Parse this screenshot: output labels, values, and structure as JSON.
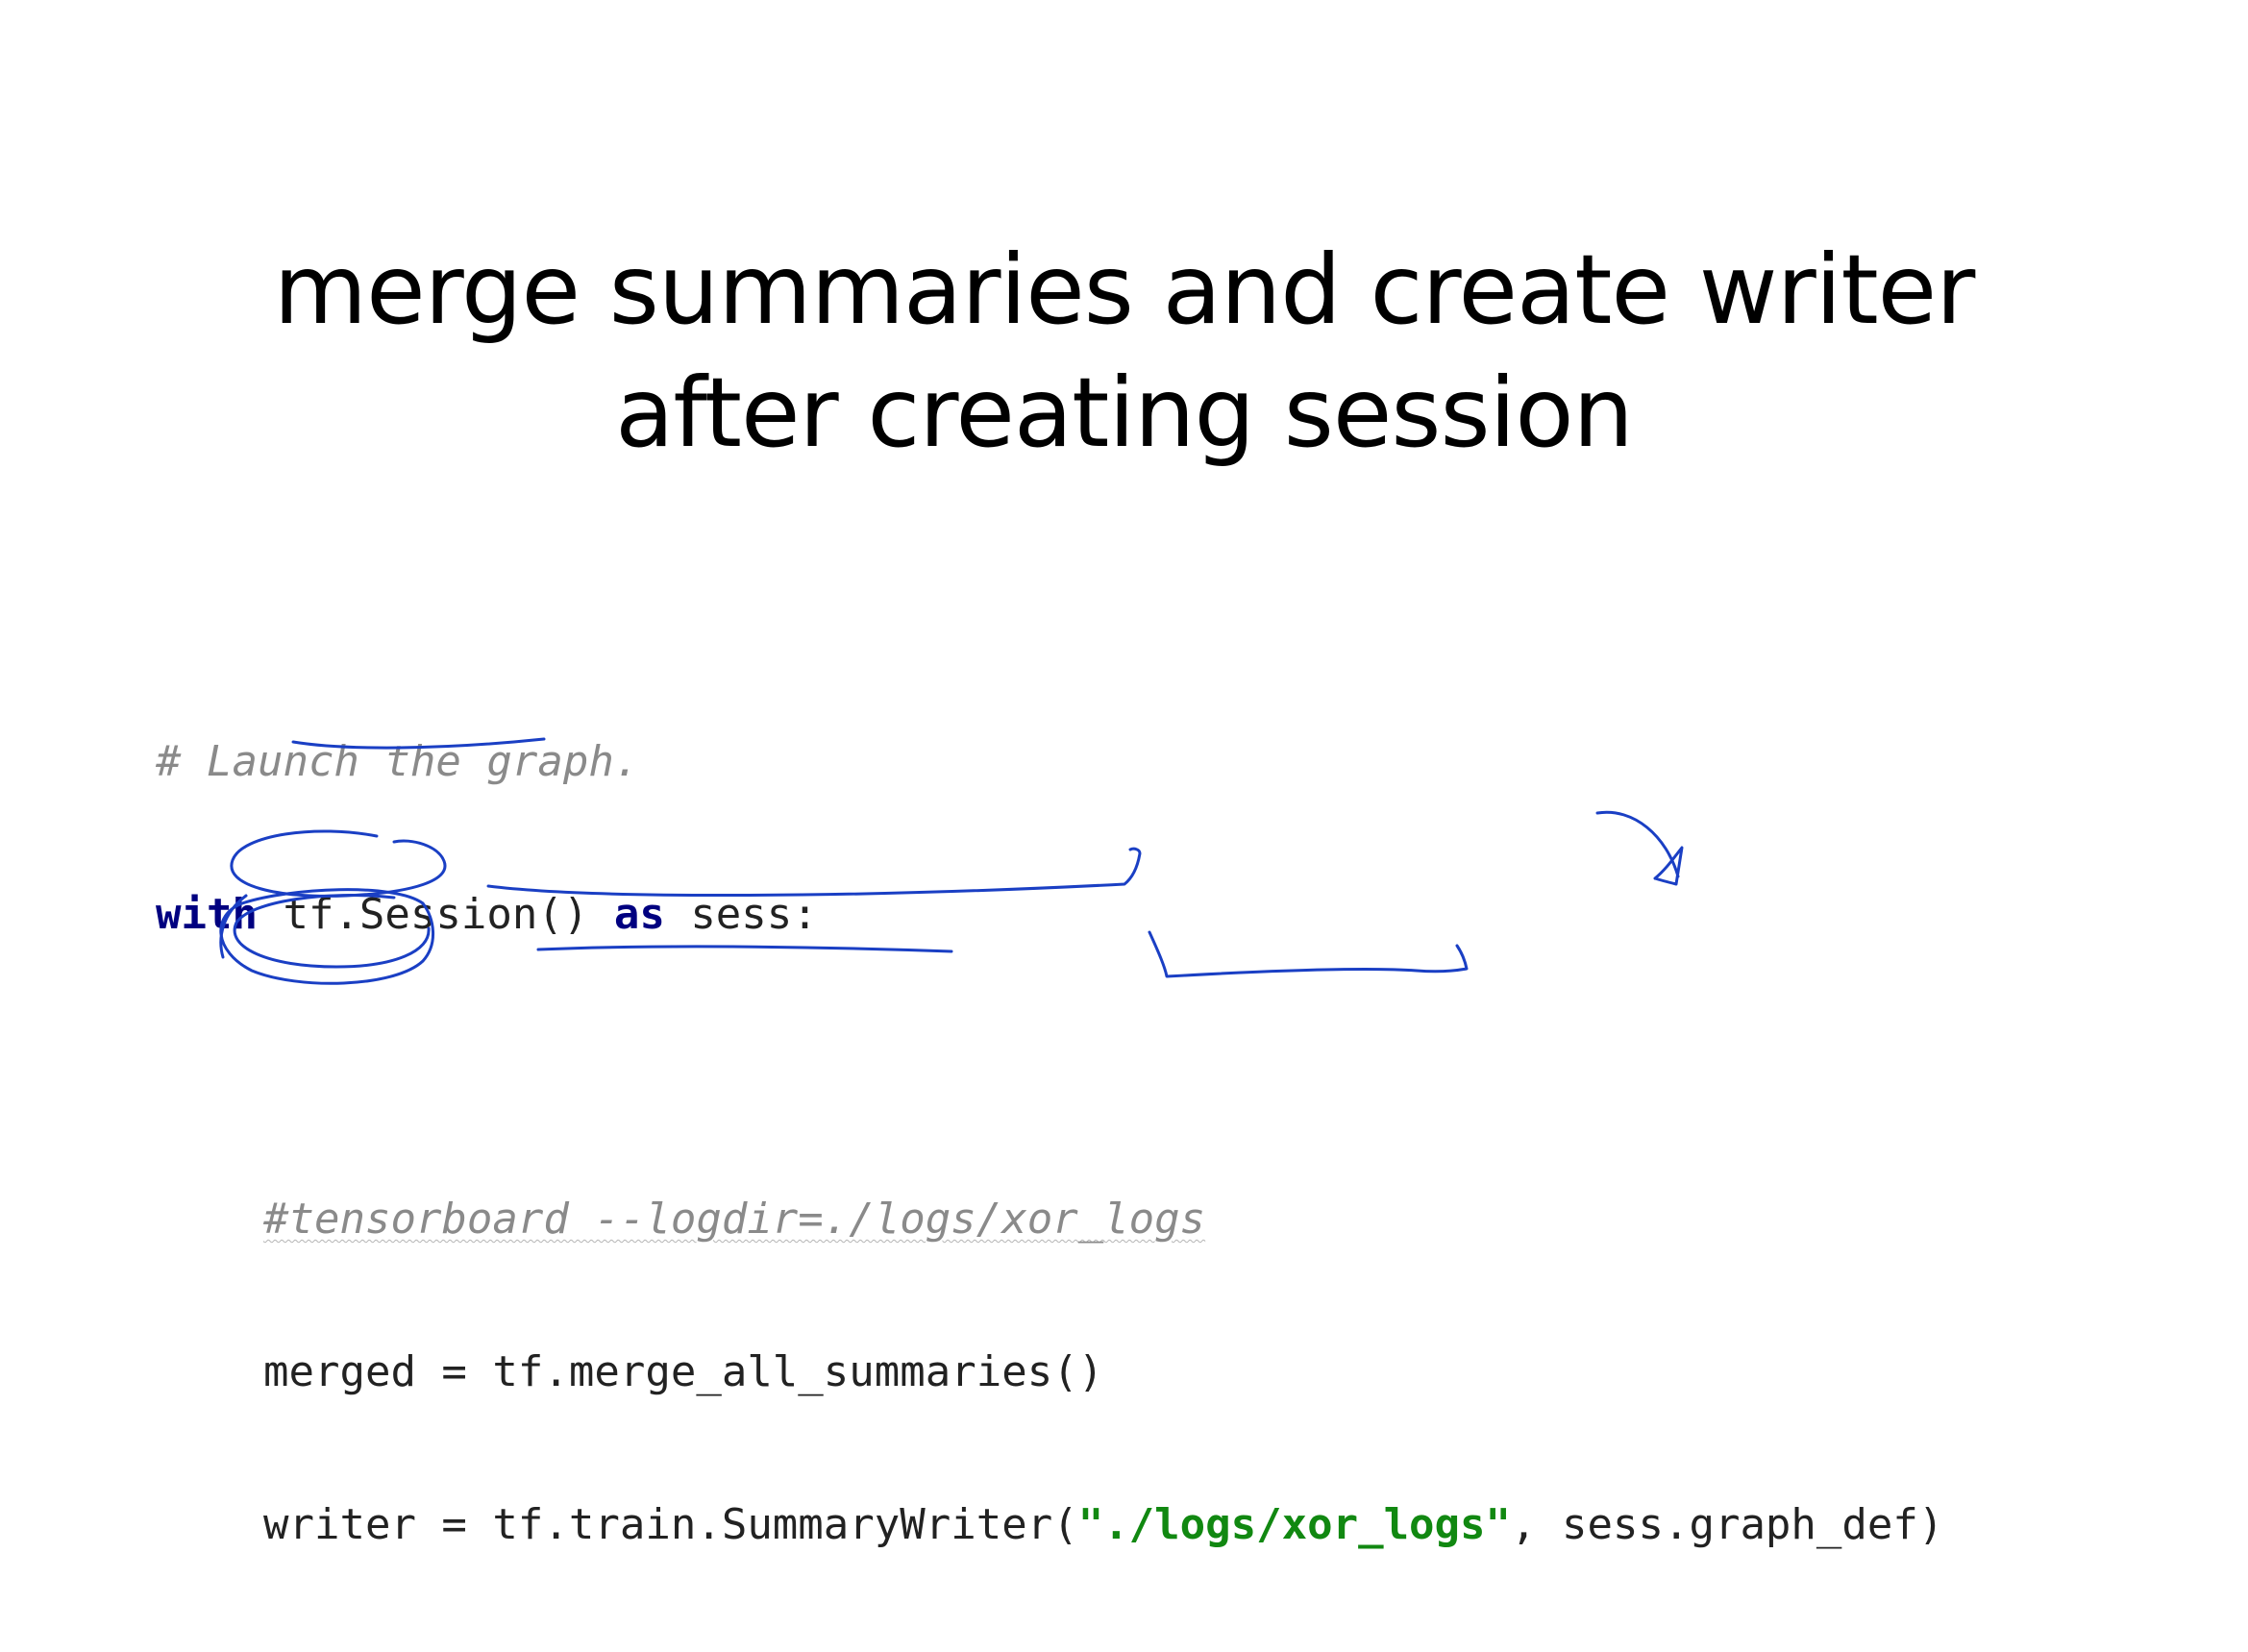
{
  "slide": {
    "title_line1": "merge summaries and create writer",
    "title_line2": "after creating session"
  },
  "code": {
    "line1_comment": "# Launch the graph.",
    "line2_kw_with": "with",
    "line2_call": " tf.Session() ",
    "line2_kw_as": "as",
    "line2_rest": " sess:",
    "line3_comment": "#tensorboard --logdir=./logs/xor_logs",
    "line4_text": "merged = tf.merge_all_summaries()",
    "line5_prefix": "writer = tf.train.SummaryWriter(",
    "line5_string": "\"./logs/xor_logs\"",
    "line5_suffix": ", sess.graph_def)"
  },
  "colors": {
    "background": "#ffffff",
    "title_text": "#000000",
    "code_text": "#222222",
    "comment": "#8a8a8a",
    "keyword": "#000080",
    "string": "#118811",
    "ink_annotation": "#1a3fc4"
  }
}
